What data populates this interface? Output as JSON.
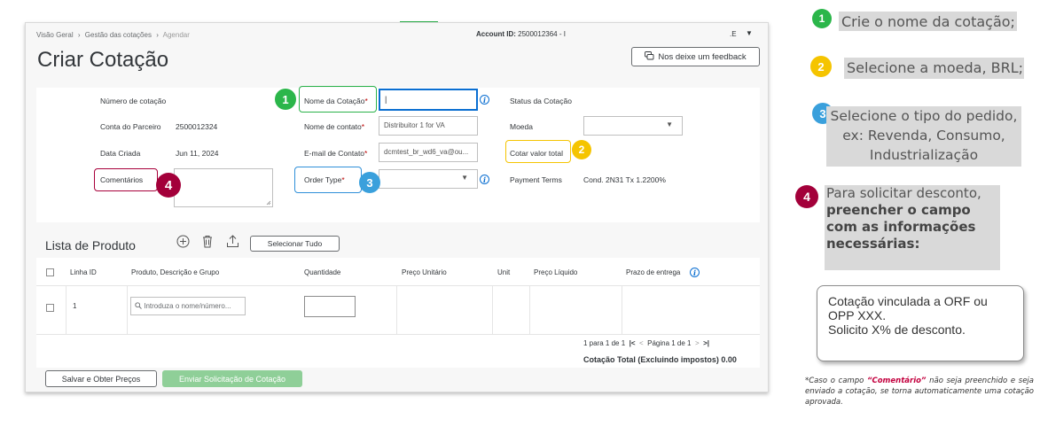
{
  "breadcrumb": [
    "Visão Geral",
    "›",
    "Gestão das cotações",
    "›",
    "Agendar"
  ],
  "account": {
    "label": "Account ID:",
    "value": "2500012364 - I",
    "suffix": ".E",
    "caret": "▼"
  },
  "page_title": "Criar Cotação",
  "feedback_button": "Nos deixe um feedback",
  "form": {
    "quote_number_label": "Número de cotação",
    "partner_account_label": "Conta do Parceiro",
    "partner_account_value": "2500012324",
    "created_date_label": "Data Criada",
    "created_date_value": "Jun 11, 2024",
    "comments_label": "Comentários",
    "quote_name_label": "Nome da Cotação",
    "quote_name_value": "|",
    "contact_name_label": "Nome de contato",
    "contact_name_value": "Distribuitor 1 for VA",
    "contact_email_label": "E-mail de Contato",
    "contact_email_value": "dcmtest_br_wd6_va@ou...",
    "order_type_label": "Order Type",
    "required_mark": "*",
    "status_label": "Status da Cotação",
    "currency_label": "Moeda",
    "total_value_label": "Cotar valor total",
    "payment_terms_label": "Payment Terms",
    "payment_terms_value": "Cond. 2N31 Tx 1.2200%"
  },
  "markers": [
    "1",
    "2",
    "3",
    "4"
  ],
  "product_list": {
    "title": "Lista de Produto",
    "select_all": "Selecionar Tudo",
    "columns": [
      "Linha ID",
      "Produto, Descrição e Grupo",
      "Quantidade",
      "Preço Unitário",
      "Unit",
      "Preço Líquido",
      "Prazo de entrega"
    ],
    "row": {
      "line_id": "1",
      "search_placeholder": "Introduza o nome/número..."
    },
    "pager": {
      "range": "1 para 1 de 1",
      "first": "|<",
      "prev": "<",
      "page": "Página 1 de 1",
      "next": ">",
      "last": ">|"
    },
    "total": "Cotação Total (Excluindo impostos) 0.00"
  },
  "buttons": {
    "save": "Salvar e Obter Preços",
    "send": "Enviar Solicitação de Cotação"
  },
  "annotations": {
    "step1": "Crie o nome da cotação;",
    "step2": "Selecione a moeda, BRL;",
    "step3": "Selecione o tipo do pedido, ex: Revenda, Consumo, Industrialização",
    "step4_a": "Para solicitar desconto,",
    "step4_b": "preencher o campo com as informações necessárias:",
    "callout_line1": "Cotação vinculada a ORF ou OPP XXX.",
    "callout_line2": "Solicito X% de desconto.",
    "footnote_a": "*Caso o campo ",
    "footnote_em": "“Comentário”",
    "footnote_b": " não seja preenchido e seja enviado a cotação, se torna automaticamente uma cotação aprovada."
  },
  "colors": {
    "green": "#2bb64a",
    "yellow": "#f5c400",
    "blue": "#3aa0dc",
    "red": "#a3003a",
    "primary": "#0a6ed1",
    "disabled_green": "#8fcf98"
  }
}
